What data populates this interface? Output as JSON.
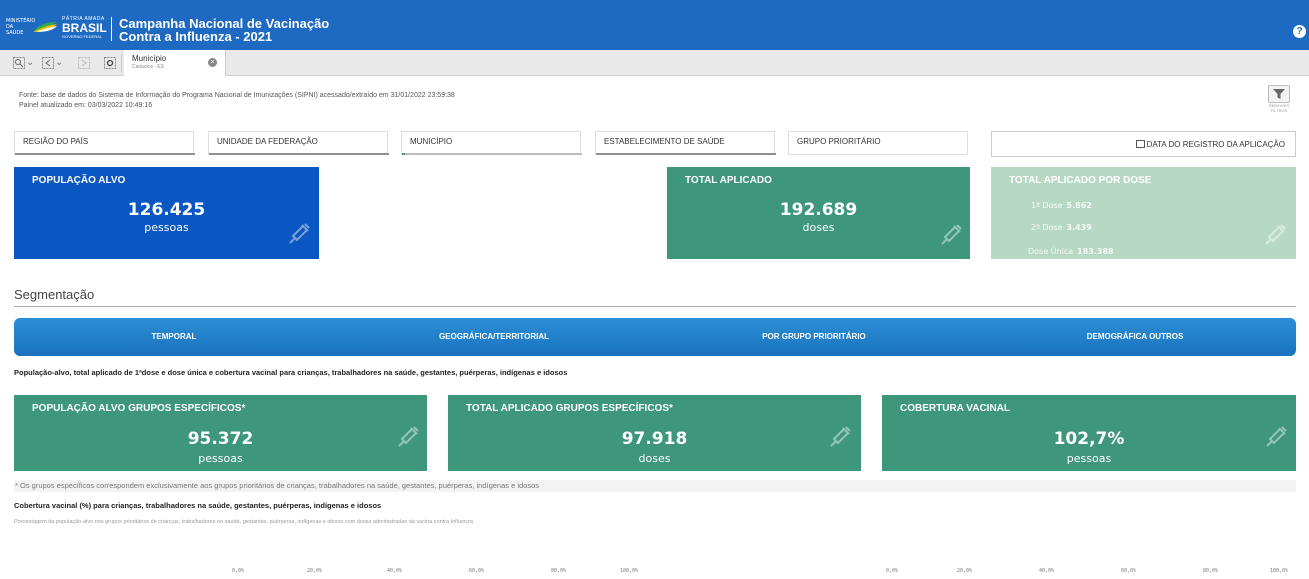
{
  "header": {
    "ministry": "MINISTÉRIO DA SAÚDE",
    "brand_top": "PÁTRIA AMADA",
    "brand_main": "BRASIL",
    "brand_sub": "GOVERNO FEDERAL",
    "title_line1": "Campanha Nacional de Vacinação",
    "title_line2": "Contra a Influenza - 2021",
    "help": "?"
  },
  "toolbar": {
    "selection_title": "Município",
    "selection_value": "Cariacica - ES",
    "close": "×"
  },
  "source": {
    "line1": "Fonte: base de dados do Sistema de Informação do Programa Nacional de Imunizações (SIPNI) acessado/extraído em 31/01/2022 23:59:38",
    "line2": "Painel atualizado em: 03/03/2022 10:49:16"
  },
  "filter_button": {
    "label_line1": "REMOVER",
    "label_line2": "FILTROS"
  },
  "filters": {
    "regiao": "REGIÃO DO PAÍS",
    "uf": "UNIDADE DA FEDERAÇÃO",
    "municipio": "MUNICÍPIO",
    "estabelecimento": "ESTABELECIMENTO DE SAÚDE",
    "grupo": "GRUPO PRIORITÁRIO",
    "data": "DATA DO REGISTRO DA APLICAÇÃO"
  },
  "kpis": {
    "populacao": {
      "title": "POPULAÇÃO ALVO",
      "value": "126.425",
      "unit": "pessoas"
    },
    "total": {
      "title": "TOTAL APLICADO",
      "value": "192.689",
      "unit": "doses"
    },
    "por_dose": {
      "title": "TOTAL APLICADO POR DOSE",
      "d1_label": "1ª Dose",
      "d1_value": "5.862",
      "d2_label": "2ª Dose",
      "d2_value": "3.439",
      "du_label": "Dose Única",
      "du_value": "183.388"
    }
  },
  "segmentacao": {
    "title": "Segmentação",
    "tabs": [
      "TEMPORAL",
      "GEOGRÁFICA/TERRITORIAL",
      "POR GRUPO PRIORITÁRIO",
      "DEMOGRÁFICA OUTROS"
    ]
  },
  "section1": "População-alvo, total aplicado de 1ªdose e dose única e cobertura vacinal para crianças, trabalhadores na saúde, gestantes, puérperas, indígenas e idosos",
  "kpis2": {
    "pop_grupos": {
      "title": "POPULAÇÃO ALVO GRUPOS ESPECÍFICOS*",
      "value": "95.372",
      "unit": "pessoas"
    },
    "total_grupos": {
      "title": "TOTAL APLICADO GRUPOS ESPECÍFICOS*",
      "value": "97.918",
      "unit": "doses"
    },
    "cobertura": {
      "title": "COBERTURA VACINAL",
      "value": "102,7%",
      "unit": "pessoas"
    }
  },
  "footnote": "* Os grupos específicos correspondem exclusivamente aos grupos prioritários de crianças, trabalhadores na saúde, gestantes, puérperas, indígenas e idosos",
  "section2": {
    "title": "Cobertura vacinal (%) para crianças, trabalhadores na saúde, gestantes, puérperas, indígenas e idosos",
    "subtitle": "Porcentagem da população-alvo nos grupos prioritários de crianças, trabalhadores na saúde, gestantes, puérperas, indígenas e idosos com doses administradas da vacina contra Influenza"
  },
  "axis_left": [
    "0,0%",
    "20,0%",
    "40,0%",
    "60,0%",
    "80,0%",
    "100,0%"
  ],
  "axis_right": [
    "0,0%",
    "20,0%",
    "40,0%",
    "60,0%",
    "80,0%",
    "100,0%"
  ],
  "colors": {
    "header": "#1e6ac2",
    "blue_card": "#0a56c2",
    "green_card": "#3e967b",
    "light_green_card": "#b7d9c3"
  }
}
